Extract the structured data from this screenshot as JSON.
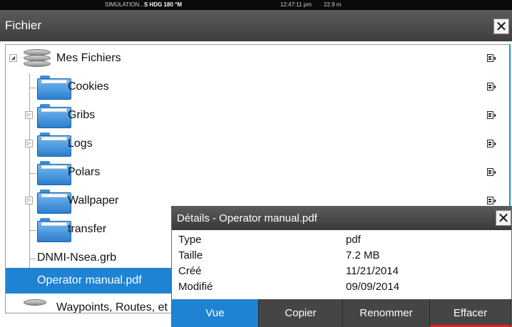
{
  "status_bar": {
    "simulation": "SIMULATION...",
    "heading": "S HDG 180 °M",
    "time": "12:47:11 pm",
    "depth": "22.9 m"
  },
  "window": {
    "title": "Fichier"
  },
  "tree": {
    "root": "Mes Fichiers",
    "items": [
      {
        "label": "Cookies"
      },
      {
        "label": "Gribs"
      },
      {
        "label": "Logs"
      },
      {
        "label": "Polars"
      },
      {
        "label": "Wallpaper"
      },
      {
        "label": "transfer"
      },
      {
        "label": "DNMI-Nsea.grb"
      },
      {
        "label": "Operator manual.pdf"
      },
      {
        "label": "Waypoints, Routes, et tra"
      }
    ]
  },
  "details": {
    "title": "Détails - Operator manual.pdf",
    "rows": [
      {
        "key": "Type",
        "value": "pdf"
      },
      {
        "key": "Taille",
        "value": "7.2 MB"
      },
      {
        "key": "Créé",
        "value": "11/21/2014"
      },
      {
        "key": "Modifié",
        "value": "09/09/2014"
      }
    ],
    "buttons": [
      "Vue",
      "Copier",
      "Renommer",
      "Effacer"
    ]
  },
  "colors": {
    "selection": "#1f83d3",
    "titlebar": "#4a4a4a",
    "folder": "#3f8fd8",
    "delete_accent": "#d8262a"
  }
}
